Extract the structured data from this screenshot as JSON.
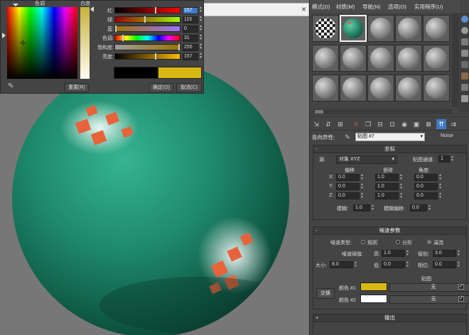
{
  "viewport": {
    "close_glyph": "×"
  },
  "color_dialog": {
    "hue_label": "色调",
    "white_label": "白度",
    "rows": [
      {
        "label": "红:",
        "value": "157"
      },
      {
        "label": "绿:",
        "value": "115"
      },
      {
        "label": "蓝:",
        "value": "0"
      },
      {
        "label": "色调:",
        "value": "31"
      },
      {
        "label": "饱和度:",
        "value": "255"
      },
      {
        "label": "亮度:",
        "value": "157"
      }
    ],
    "reset_label": "重置(R)",
    "ok_label": "确定(O)",
    "cancel_label": "取消(C)",
    "old_color": "#000000",
    "new_color": "#d8b713"
  },
  "menu": [
    "模式(D)",
    "材质(M)",
    "导航(N)",
    "选项(O)",
    "实用程序(U)"
  ],
  "material_editor": {
    "map_label": "各向异性:",
    "map_name": "贴图 #7",
    "map_type": "Noise",
    "coordinates": {
      "title": "坐标",
      "source_label": "源:",
      "source_value": "对象 XYZ",
      "channel_label": "贴图通道:",
      "channel_value": "1",
      "col_offset": "偏移",
      "col_tiling": "瓷砖",
      "col_angle": "角度:",
      "axis_x": "X:",
      "axis_y": "Y:",
      "axis_z": "Z:",
      "offset": [
        "0.0",
        "0.0",
        "0.0"
      ],
      "tiling": [
        "1.0",
        "1.0",
        "1.0"
      ],
      "angle": [
        "0.0",
        "0.0",
        "0.0"
      ],
      "blur_label": "模糊:",
      "blur_value": "1.0",
      "blur_offset_label": "模糊偏移:",
      "blur_offset_value": "0.0"
    },
    "noise": {
      "title": "噪波参数",
      "type_label": "噪波类型:",
      "types": [
        "规则",
        "分形",
        "湍流"
      ],
      "selected_type": "湍流",
      "threshold_label": "噪波阈值:",
      "high_label": "高:",
      "high_value": "1.0",
      "levels_label": "级别:",
      "levels_value": "3.0",
      "low_label": "低:",
      "low_value": "0.0",
      "phase_label": "相位:",
      "phase_value": "0.0",
      "size_label": "大小:",
      "size_value": "8.0",
      "maps_label": "贴图",
      "swap_label": "交换",
      "color1_label": "颜色 #1",
      "color2_label": "颜色 #2",
      "color1": "#d8b713",
      "color2": "#ffffff",
      "none1": "无",
      "none2": "无"
    },
    "output": {
      "title": "输出"
    }
  },
  "colors": {
    "sphere": "#1f8a6c",
    "accent_blue": "#3f7bc4"
  }
}
